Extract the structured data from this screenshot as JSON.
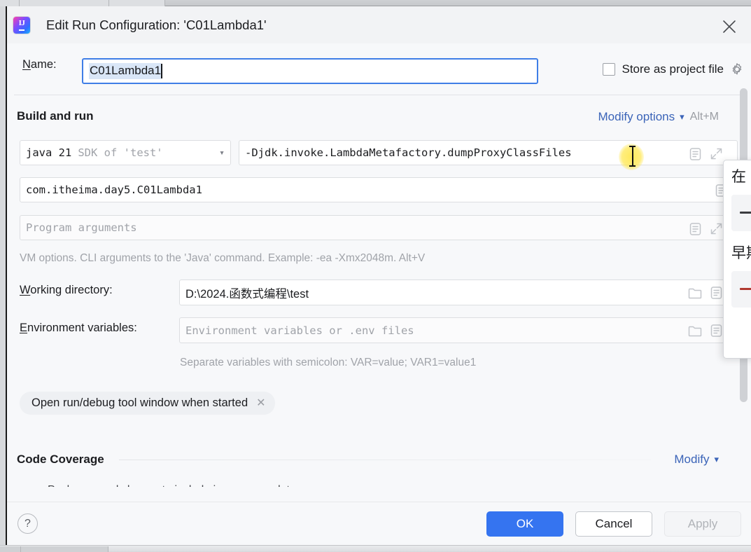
{
  "window": {
    "title": "Edit Run Configuration: 'C01Lambda1'",
    "app_icon": "intellij-idea-logo",
    "close_icon": "close-icon"
  },
  "name_row": {
    "label": "Name:",
    "label_mnemonic": "N",
    "value": "C01Lambda1",
    "store_as_project_file": {
      "label": "Store as project file",
      "checked": false,
      "gear_icon": "gear-icon"
    }
  },
  "build_and_run": {
    "heading": "Build and run",
    "modify_options": {
      "label": "Modify options",
      "chevron": "⌄",
      "shortcut": "Alt+M"
    },
    "sdk": {
      "name": "java 21",
      "suffix": "SDK of 'test'",
      "chevron_icon": "chevron-down-icon"
    },
    "vm_options": {
      "value": "-Djdk.invoke.LambdaMetafactory.dumpProxyClassFiles",
      "macro_icon": "document-icon",
      "expand_icon": "expand-diagonal-icon"
    },
    "main_class": {
      "value": "com.itheima.day5.C01Lambda1",
      "macro_icon": "document-icon"
    },
    "program_arguments": {
      "placeholder": "Program arguments",
      "macro_icon": "document-icon",
      "expand_icon": "expand-diagonal-icon"
    },
    "vm_hint": "VM options. CLI arguments to the 'Java' command. Example: -ea -Xmx2048m. Alt+V",
    "working_directory": {
      "label": "Working directory:",
      "label_mnemonic": "W",
      "value": "D:\\2024.函数式编程\\test",
      "browse_icon": "folder-icon",
      "macro_icon": "document-icon"
    },
    "environment_variables": {
      "label": "Environment variables:",
      "label_mnemonic": "E",
      "placeholder": "Environment variables or .env files",
      "browse_icon": "folder-icon",
      "macro_icon": "document-icon"
    },
    "env_hint": "Separate variables with semicolon: VAR=value; VAR1=value1",
    "chip": {
      "label": "Open run/debug tool window when started",
      "remove_icon": "close-small-icon"
    }
  },
  "code_coverage": {
    "heading": "Code Coverage",
    "modify": {
      "label": "Modify",
      "chevron_icon": "chevron-down-icon"
    },
    "truncated_row": "Packages and classes to include in coverage data"
  },
  "overlay_popup": {
    "line1": "在",
    "line2": "早期"
  },
  "footer": {
    "help_icon": "?",
    "ok": "OK",
    "cancel": "Cancel",
    "apply": "Apply"
  },
  "colors": {
    "accent_blue": "#3574f0",
    "link_blue": "#3b64b8",
    "focus_border": "#3f7ee6",
    "selection": "#d9e6f7",
    "cursor_highlight": "#ffe646"
  }
}
